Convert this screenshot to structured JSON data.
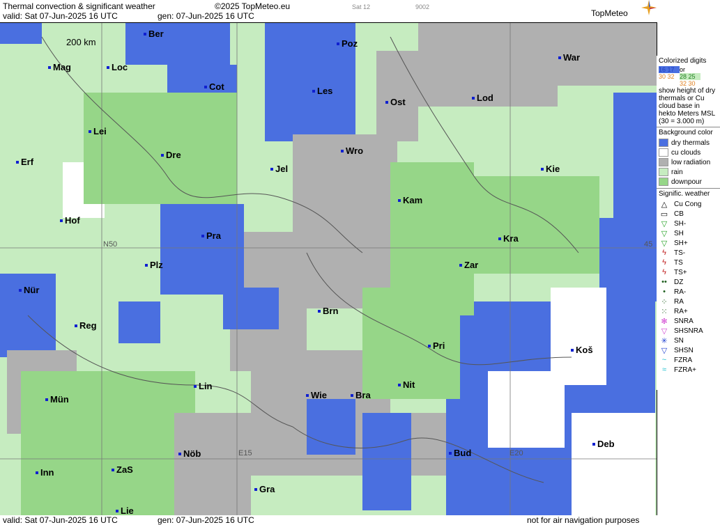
{
  "header": {
    "title": "Thermal convection & significant weather",
    "copyright": "©2025 TopMeteo.eu",
    "sat_label": "Sat 12",
    "code": "9002",
    "valid": "valid:  Sat  07-Jun-2025  16 UTC",
    "gen": "gen: 07-Jun-2025 16 UTC",
    "brand": "TopMeteo"
  },
  "map": {
    "scale": "200 km",
    "grid_labels": [
      "N50",
      "E15",
      "E20",
      "45"
    ],
    "cities": [
      "Ber",
      "Poz",
      "War",
      "Mag",
      "Loc",
      "Cot",
      "Les",
      "Lod",
      "Ost",
      "Lei",
      "Dre",
      "Wro",
      "Erf",
      "Jel",
      "Kie",
      "Kam",
      "Hof",
      "Pra",
      "Kra",
      "Zar",
      "Plz",
      "Nür",
      "Brn",
      "Reg",
      "Pri",
      "Koš",
      "Nit",
      "Lin",
      "Mün",
      "Wie",
      "Bra",
      "Deb",
      "Nöb",
      "Bud",
      "Inn",
      "ZaS",
      "Gra",
      "Lie"
    ],
    "colors": {
      "dry_thermals": "#4a6fe0",
      "cu_clouds": "#ffffff",
      "low_radiation": "#b0b0b0",
      "rain": "#c6ecc0",
      "downpour": "#96d688"
    }
  },
  "legend": {
    "colorized_title": "Colorized digits",
    "digits": [
      "16 17",
      "30 32",
      "28 25",
      "32 30"
    ],
    "or": "or",
    "note": "show height of dry thermals or Cu cloud base in hekto Meters MSL",
    "note2": "(30 = 3.000 m)",
    "bg_title": "Background color",
    "bg_items": [
      "dry thermals",
      "cu clouds",
      "low radiation",
      "rain",
      "downpour"
    ],
    "wx_title": "Signific. weather",
    "wx_items": [
      "Cu Cong",
      "CB",
      "SH-",
      "SH",
      "SH+",
      "TS-",
      "TS",
      "TS+",
      "DZ",
      "RA-",
      "RA",
      "RA+",
      "SNRA",
      "SHSNRA",
      "SN",
      "SHSN",
      "FZRA",
      "FZRA+"
    ],
    "wx_icons": [
      "cu-cong-icon",
      "cb-icon",
      "shower-light-icon",
      "shower-icon",
      "shower-heavy-icon",
      "thunderstorm-light-icon",
      "thunderstorm-icon",
      "thunderstorm-heavy-icon",
      "drizzle-icon",
      "rain-light-icon",
      "rain-icon",
      "rain-heavy-icon",
      "snow-rain-icon",
      "snow-rain-shower-icon",
      "snow-icon",
      "snow-shower-icon",
      "freezing-rain-icon",
      "freezing-rain-heavy-icon"
    ]
  },
  "footer": {
    "valid": "valid:  Sat  07-Jun-2025  16 UTC",
    "gen": "gen: 07-Jun-2025 16 UTC",
    "disclaimer": "not for air navigation purposes"
  }
}
